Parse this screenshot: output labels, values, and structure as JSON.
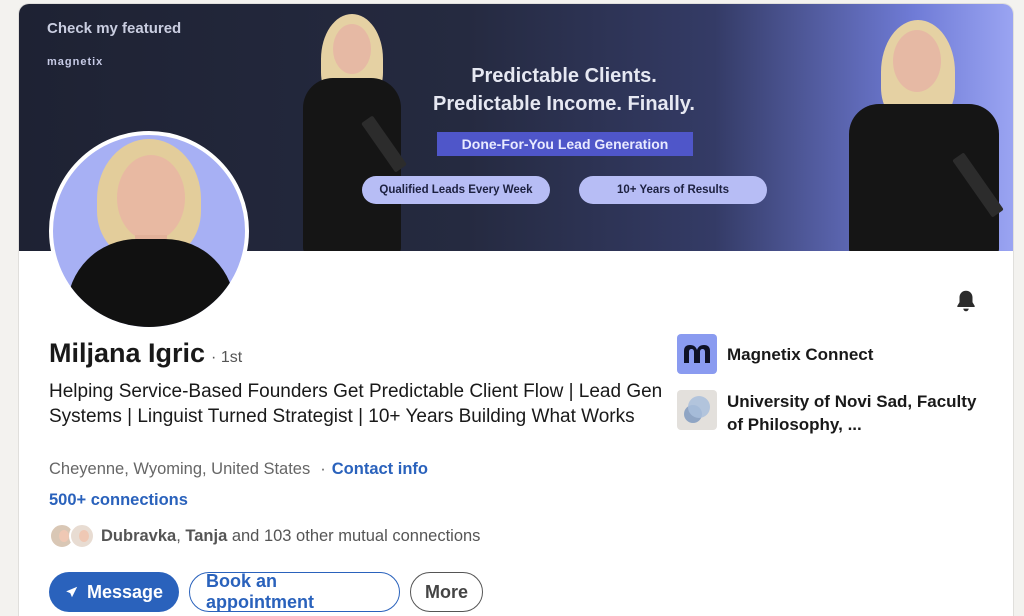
{
  "banner": {
    "title": "Check my featured",
    "logo": "magnetix",
    "headline_line1": "Predictable Clients.",
    "headline_line2": "Predictable Income. Finally.",
    "tag": "Done-For-You Lead Generation",
    "pill1": "Qualified Leads Every Week",
    "pill2": "10+ Years of Results"
  },
  "profile": {
    "name": "Miljana Igric",
    "degree": "· 1st",
    "headline": "Helping Service-Based Founders Get Predictable Client Flow | Lead Gen Systems | Linguist Turned Strategist | 10+ Years Building What Works",
    "location": "Cheyenne, Wyoming, United States",
    "separator": "·",
    "contact_info": "Contact info",
    "connections": "500+ connections",
    "mutual_name1": "Dubravka",
    "mutual_sep": ", ",
    "mutual_name2": "Tanja",
    "mutual_rest": " and 103 other mutual connections"
  },
  "actions": {
    "message": "Message",
    "book": "Book an appointment",
    "more": "More"
  },
  "organizations": [
    {
      "name": "Magnetix Connect",
      "icon": "magnetix-logo"
    },
    {
      "name": "University of Novi Sad, Faculty of Philosophy, ...",
      "icon": "university-logo"
    }
  ],
  "colors": {
    "accent": "#2a62bc",
    "banner_tag": "#4f56c9",
    "banner_pill": "#b7bdf5",
    "avatar_bg": "#a7b0f4"
  },
  "icons": {
    "bell": "bell-icon",
    "send": "send-icon"
  }
}
